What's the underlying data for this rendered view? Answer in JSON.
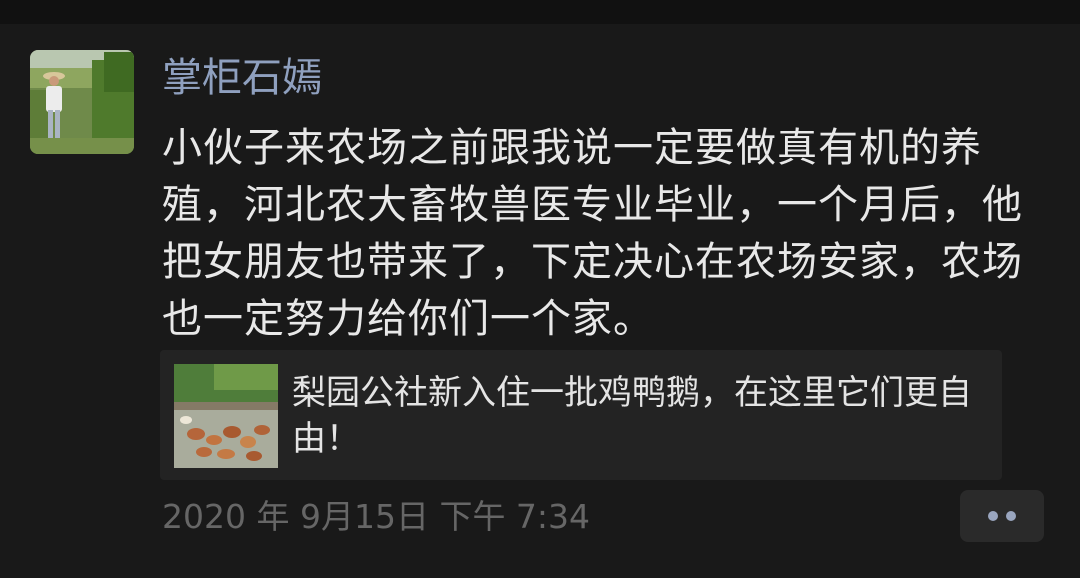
{
  "post": {
    "author": "掌柜石嫣",
    "text": "小伙子来农场之前跟我说一定要做真有机的养殖，河北农大畜牧兽医专业毕业，一个月后，他把女朋友也带来了，下定决心在农场安家，农场也一定努力给你们一个家。",
    "timestamp": "2020 年 9月15日 下午 7:34"
  },
  "share": {
    "title": "梨园公社新入住一批鸡鸭鹅，在这里它们更自由！"
  },
  "actions": {
    "more_icon": "more-dots-icon"
  },
  "colors": {
    "background": "#191919",
    "author_name": "#8fa0bf",
    "body_text": "#e8e8e8",
    "timestamp": "#666666",
    "card_background": "#232323",
    "more_button": "#2a2a2a",
    "more_dots": "#9aa6bf"
  }
}
